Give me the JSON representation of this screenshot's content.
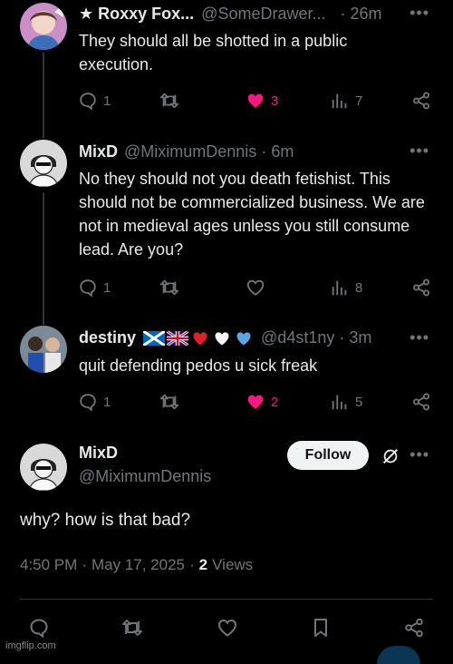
{
  "replies": [
    {
      "display_name": "★ Roxxy Fox...",
      "handle": "@SomeDrawer...",
      "sep": "·",
      "time": "26m",
      "text": "They should all be shotted in a public execution.",
      "replies_count": "1",
      "likes_count": "3",
      "views_count": "7",
      "liked": true
    },
    {
      "display_name": "MixD",
      "handle": "@MiximumDennis",
      "sep": "·",
      "time": "6m",
      "text": "No they should not you death fetishist. This should not be commercialized business. We are not in medieval ages unless you still consume lead. Are you?",
      "replies_count": "1",
      "likes_count": "",
      "views_count": "8",
      "liked": false
    },
    {
      "display_name": "destiny",
      "handle": "@d4st1ny",
      "sep": "·",
      "time": "3m",
      "text": "quit defending pedos u sick freak",
      "replies_count": "1",
      "likes_count": "2",
      "views_count": "5",
      "liked": true
    }
  ],
  "main_post": {
    "display_name": "MixD",
    "handle": "@MiximumDennis",
    "follow_label": "Follow",
    "text": "why? how is that bad?",
    "time": "4:50 PM",
    "sep1": "·",
    "date": "May 17, 2025",
    "sep2": "·",
    "views_count": "2",
    "views_label": "Views"
  },
  "watermark": "imgflip.com",
  "colors": {
    "accent_pink": "#f91880",
    "muted": "#71767b",
    "text": "#e7e9ea",
    "background": "#000000"
  },
  "icons": [
    "reply-icon",
    "retweet-icon",
    "heart-icon",
    "views-icon",
    "share-icon",
    "bookmark-icon",
    "grok-icon",
    "more-icon"
  ]
}
